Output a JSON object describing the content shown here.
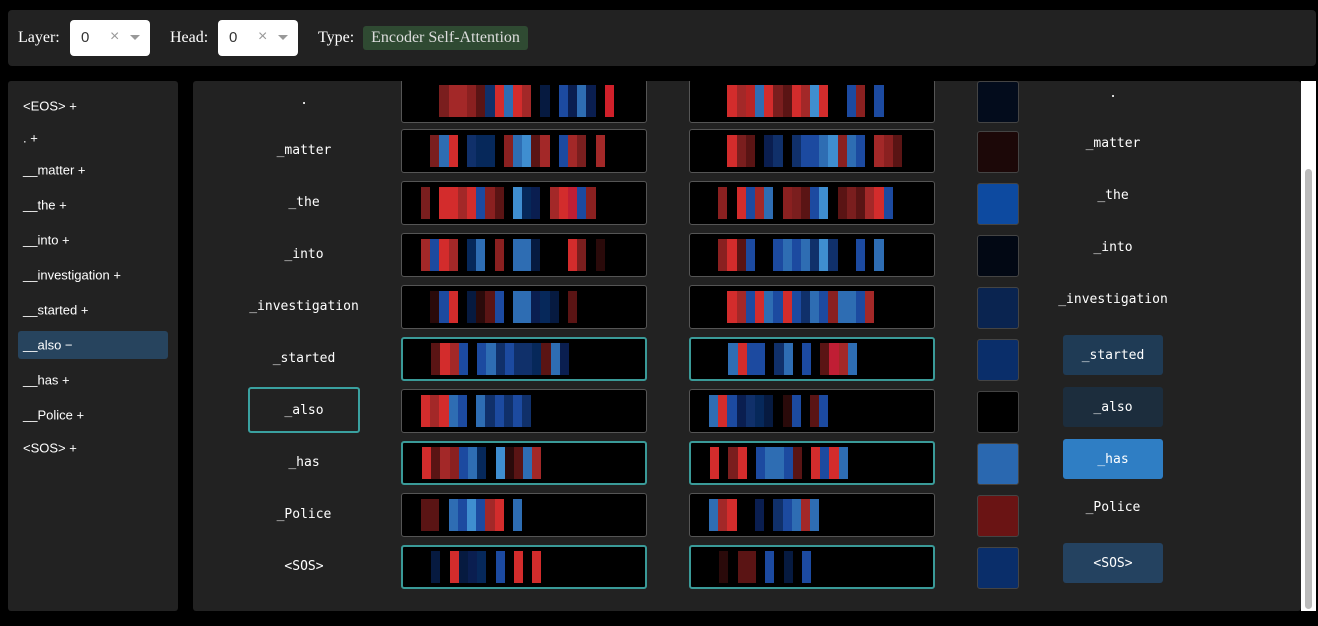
{
  "toolbar": {
    "layer_label": "Layer:",
    "layer_value": "0",
    "head_label": "Head:",
    "head_value": "0",
    "clear_glyph": "×",
    "type_label": "Type:",
    "type_value": "Encoder Self-Attention",
    "type_color": "#2f4a32"
  },
  "sidebar": {
    "items": [
      {
        "label": "<EOS> +",
        "active": false
      },
      {
        "label": ". +",
        "active": false
      },
      {
        "label": "__matter +",
        "active": false
      },
      {
        "label": "__the +",
        "active": false
      },
      {
        "label": "__into +",
        "active": false
      },
      {
        "label": "__investigation +",
        "active": false
      },
      {
        "label": "__started +",
        "active": false
      },
      {
        "label": "__also −",
        "active": true
      },
      {
        "label": "__has +",
        "active": false
      },
      {
        "label": "__Police +",
        "active": false
      },
      {
        "label": "<SOS> +",
        "active": false
      }
    ]
  },
  "main": {
    "rows": [
      {
        "token": ".",
        "out_token": ".",
        "selected": false,
        "hl": false,
        "swatch": "#030c1c",
        "out_bg": "",
        "cells_a": [
          "#000",
          "#000",
          "#7a1e1e",
          "#a32828",
          "#a32828",
          "#8a2020",
          "#5a1414",
          "#10306a",
          "#d32c2c",
          "#2e6db3",
          "#d32c2c",
          "#a32828",
          "#000",
          "#061a40",
          "#000",
          "#1c4aa0",
          "#0a1e50",
          "#2e6db3",
          "#0a1e50",
          "#000",
          "#d0202a",
          "#000"
        ],
        "cells_b": [
          "#000",
          "#000",
          "#d32c2c",
          "#a32828",
          "#b82424",
          "#2e6db3",
          "#d32c2c",
          "#7a1e1e",
          "#5a1414",
          "#d32c2c",
          "#a32828",
          "#3f8ed0",
          "#d32c2c",
          "#000",
          "#000",
          "#1c4aa0",
          "#8a2020",
          "#000",
          "#1c4aa0",
          "#000",
          "#000",
          "#000"
        ]
      },
      {
        "token": "_matter",
        "out_token": "_matter",
        "selected": false,
        "hl": false,
        "swatch": "#1c0808",
        "out_bg": "",
        "cells_a": [
          "#000",
          "#7a1e1e",
          "#2e6db3",
          "#d32c2c",
          "#000",
          "#10306a",
          "#06285a",
          "#06285a",
          "#000",
          "#8a2020",
          "#2e6db3",
          "#3f8ed0",
          "#5a1414",
          "#a32828",
          "#000",
          "#1c4aa0",
          "#a32828",
          "#7a1e1e",
          "#000",
          "#a32828",
          "#000",
          "#000"
        ],
        "cells_b": [
          "#000",
          "#000",
          "#d32c2c",
          "#7a1e1e",
          "#5a1414",
          "#000",
          "#0a1e50",
          "#10306a",
          "#000",
          "#10306a",
          "#1c4aa0",
          "#1c4aa0",
          "#2e6db3",
          "#3f8ed0",
          "#8a2020",
          "#2e6db3",
          "#1c4aa0",
          "#000",
          "#a32828",
          "#8a2020",
          "#5a1414",
          "#000"
        ]
      },
      {
        "token": "_the",
        "out_token": "_the",
        "selected": false,
        "hl": false,
        "swatch": "#0d4aa0",
        "out_bg": "",
        "cells_a": [
          "#7a1e1e",
          "#000",
          "#d32c2c",
          "#d32c2c",
          "#a32828",
          "#d32c2c",
          "#1c4aa0",
          "#8a2020",
          "#5a1414",
          "#000",
          "#3f8ed0",
          "#06285a",
          "#0a1e50",
          "#000",
          "#a32828",
          "#d32c2c",
          "#c01e34",
          "#1c4aa0",
          "#8a2020",
          "#000",
          "#000",
          "#000"
        ],
        "cells_b": [
          "#000",
          "#8a2020",
          "#000",
          "#d32c2c",
          "#1c4aa0",
          "#a32828",
          "#2e6db3",
          "#000",
          "#8a2020",
          "#7a1e1e",
          "#5a1414",
          "#1c4aa0",
          "#3f8ed0",
          "#000",
          "#5a1414",
          "#7a1e1e",
          "#5a1414",
          "#a32828",
          "#d32c2c",
          "#1c4aa0",
          "#000",
          "#000"
        ]
      },
      {
        "token": "_into",
        "out_token": "_into",
        "selected": false,
        "hl": false,
        "swatch": "#020814",
        "out_bg": "",
        "cells_a": [
          "#a32828",
          "#1c4aa0",
          "#d32c2c",
          "#a32828",
          "#000",
          "#06285a",
          "#2e6db3",
          "#000",
          "#8a2020",
          "#000",
          "#2e6db3",
          "#2e6db3",
          "#061a40",
          "#000",
          "#000",
          "#000",
          "#d32c2c",
          "#7a1e1e",
          "#000",
          "#2a0a0a",
          "#000",
          "#000"
        ],
        "cells_b": [
          "#000",
          "#8a2020",
          "#d32c2c",
          "#5a1414",
          "#1c4aa0",
          "#000",
          "#000",
          "#1c4aa0",
          "#2e6db3",
          "#1c4aa0",
          "#2e6db3",
          "#10306a",
          "#3f8ed0",
          "#10306a",
          "#000",
          "#000",
          "#1c4aa0",
          "#000",
          "#2e6db3",
          "#000",
          "#000",
          "#000"
        ]
      },
      {
        "token": "_investigation",
        "out_token": "_investigation",
        "selected": false,
        "hl": false,
        "swatch": "#0a2450",
        "out_bg": "",
        "cells_a": [
          "#000",
          "#2a0a0a",
          "#1c4aa0",
          "#d32c2c",
          "#000",
          "#061a40",
          "#2a0a0a",
          "#5a1414",
          "#1c4aa0",
          "#000",
          "#2e6db3",
          "#2e6db3",
          "#0a1e50",
          "#06285a",
          "#061a40",
          "#000",
          "#5a1414",
          "#000",
          "#000",
          "#000",
          "#000",
          "#000"
        ],
        "cells_b": [
          "#000",
          "#000",
          "#d32c2c",
          "#a32828",
          "#1c4aa0",
          "#d32c2c",
          "#2e6db3",
          "#1c4aa0",
          "#d32c2c",
          "#1c4aa0",
          "#10306a",
          "#2e6db3",
          "#1c4aa0",
          "#8a2020",
          "#2e6db3",
          "#2e6db3",
          "#1c4aa0",
          "#a32828",
          "#000",
          "#000",
          "#000",
          "#000"
        ]
      },
      {
        "token": "_started",
        "out_token": "_started",
        "selected": false,
        "hl": true,
        "swatch": "#0a2e6a",
        "out_bg": "#1f3b55",
        "cells_a": [
          "#000",
          "#5a1414",
          "#d32c2c",
          "#a32828",
          "#1c4aa0",
          "#000",
          "#1c4aa0",
          "#2e6db3",
          "#10306a",
          "#1c4aa0",
          "#10306a",
          "#10306a",
          "#06285a",
          "#5a1414",
          "#2e6db3",
          "#0a1e50",
          "#000",
          "#000",
          "#000",
          "#000",
          "#000",
          "#000"
        ],
        "cells_b": [
          "#000",
          "#000",
          "#2e6db3",
          "#d32c2c",
          "#1c4aa0",
          "#1c4aa0",
          "#000",
          "#10306a",
          "#2e6db3",
          "#000",
          "#1c4aa0",
          "#000",
          "#5a1414",
          "#c01e34",
          "#a32828",
          "#2e6db3",
          "#000",
          "#000",
          "#000",
          "#000",
          "#000",
          "#000"
        ]
      },
      {
        "token": "_also",
        "out_token": "_also",
        "selected": true,
        "hl": false,
        "swatch": "#000000",
        "out_bg": "#1c2d3d",
        "cells_a": [
          "#d32c2c",
          "#a32828",
          "#d32c2c",
          "#2e6db3",
          "#1c4aa0",
          "#000",
          "#2e6db3",
          "#10306a",
          "#1c4aa0",
          "#10306a",
          "#1c4aa0",
          "#10306a",
          "#000",
          "#000",
          "#000",
          "#000",
          "#000",
          "#000",
          "#000",
          "#000",
          "#000",
          "#000"
        ],
        "cells_b": [
          "#2e6db3",
          "#d32c2c",
          "#1c4aa0",
          "#0a1e50",
          "#10306a",
          "#06285a",
          "#061a40",
          "#000",
          "#2a0a0a",
          "#1c4aa0",
          "#000",
          "#5a1414",
          "#1c4aa0",
          "#000",
          "#000",
          "#000",
          "#000",
          "#000",
          "#000",
          "#000",
          "#000",
          "#000"
        ]
      },
      {
        "token": "_has",
        "out_token": "_has",
        "selected": false,
        "hl": true,
        "swatch": "#2a68b0",
        "out_bg": "#2f7ec4",
        "cells_a": [
          "#d32c2c",
          "#5a1414",
          "#a32828",
          "#8a2020",
          "#1c4aa0",
          "#2e6db3",
          "#06285a",
          "#000",
          "#3f8ed0",
          "#2a0a0a",
          "#5a1414",
          "#2e6db3",
          "#a32828",
          "#000",
          "#000",
          "#000",
          "#000",
          "#000",
          "#000",
          "#000",
          "#000",
          "#000"
        ],
        "cells_b": [
          "#d32c2c",
          "#000",
          "#7a1e1e",
          "#d32c2c",
          "#000",
          "#1c4aa0",
          "#2e6db3",
          "#2e6db3",
          "#1c4aa0",
          "#5a1414",
          "#000",
          "#d32c2c",
          "#1c4aa0",
          "#d32c2c",
          "#2e6db3",
          "#000",
          "#000",
          "#000",
          "#000",
          "#000",
          "#000",
          "#000"
        ]
      },
      {
        "token": "_Police",
        "out_token": "_Police",
        "selected": false,
        "hl": false,
        "swatch": "#6a1414",
        "out_bg": "",
        "cells_a": [
          "#5a1414",
          "#5a1414",
          "#000",
          "#2e6db3",
          "#1c4aa0",
          "#3f8ed0",
          "#1c4aa0",
          "#a32828",
          "#d32c2c",
          "#000",
          "#2e6db3",
          "#000",
          "#000",
          "#000",
          "#000",
          "#000",
          "#000",
          "#000",
          "#000",
          "#000",
          "#000",
          "#000"
        ],
        "cells_b": [
          "#2e6db3",
          "#a32828",
          "#d32c2c",
          "#000",
          "#000",
          "#0a1e50",
          "#000",
          "#10306a",
          "#1c4aa0",
          "#2e6db3",
          "#a32828",
          "#2e6db3",
          "#000",
          "#000",
          "#000",
          "#000",
          "#000",
          "#000",
          "#000",
          "#000",
          "#000",
          "#000"
        ]
      },
      {
        "token": "<SOS>",
        "out_token": "<SOS>",
        "selected": false,
        "hl": true,
        "swatch": "#0a2e6a",
        "out_bg": "#244260",
        "cells_a": [
          "#000",
          "#061a40",
          "#000",
          "#d32c2c",
          "#061a40",
          "#0a1e50",
          "#06285a",
          "#000",
          "#1c4aa0",
          "#000",
          "#d32c2c",
          "#000",
          "#d32c2c",
          "#000",
          "#000",
          "#000",
          "#000",
          "#000",
          "#000",
          "#000",
          "#000",
          "#000"
        ],
        "cells_b": [
          "#000",
          "#2a0a0a",
          "#000",
          "#5a1414",
          "#5a1414",
          "#000",
          "#1c4aa0",
          "#000",
          "#061a40",
          "#000",
          "#1c4aa0",
          "#000",
          "#000",
          "#000",
          "#000",
          "#000",
          "#000",
          "#000",
          "#000",
          "#000",
          "#000",
          "#000"
        ]
      }
    ]
  }
}
